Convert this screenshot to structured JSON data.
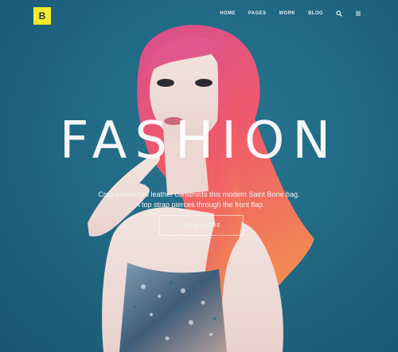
{
  "logo": {
    "letter": "B"
  },
  "nav": {
    "items": [
      "HOME",
      "PAGES",
      "WORK",
      "BLOG"
    ],
    "icons": [
      "search-icon",
      "menu-icon"
    ]
  },
  "hero": {
    "headline": "FASHION",
    "tagline_line1": "Croc-embossed leather constructs this modern Saint Bone bag.",
    "tagline_line2": "A top strap pierces through the front flap",
    "cta_label": "VIEW MORE"
  },
  "colors": {
    "background": "#1e5a73",
    "logo_bg": "#f2ea2e",
    "hair": "#e8506a"
  }
}
